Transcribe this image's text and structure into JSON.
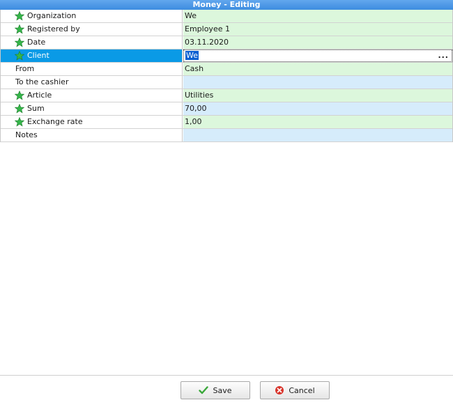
{
  "window": {
    "title": "Money - Editing"
  },
  "fields": [
    {
      "label": "Organization",
      "value": "We",
      "required": true,
      "tone": "green"
    },
    {
      "label": "Registered by",
      "value": "Employee 1",
      "required": true,
      "tone": "green"
    },
    {
      "label": "Date",
      "value": "03.11.2020",
      "required": true,
      "tone": "green"
    },
    {
      "label": "Client",
      "value": "We",
      "required": true,
      "tone": "white",
      "selected": true
    },
    {
      "label": "From",
      "value": "Cash",
      "required": false,
      "tone": "green"
    },
    {
      "label": "To the cashier",
      "value": "",
      "required": false,
      "tone": "blue"
    },
    {
      "label": "Article",
      "value": "Utilities",
      "required": true,
      "tone": "green"
    },
    {
      "label": "Sum",
      "value": "70,00",
      "required": true,
      "tone": "blue"
    },
    {
      "label": "Exchange rate",
      "value": "1,00",
      "required": true,
      "tone": "green"
    },
    {
      "label": "Notes",
      "value": "",
      "required": false,
      "tone": "blue"
    }
  ],
  "client_picker": {
    "ellipsis": "..."
  },
  "buttons": {
    "save": "Save",
    "cancel": "Cancel"
  },
  "colors": {
    "title_bar": "#3d8ce0",
    "selected_label": "#0a9ae6",
    "value_green": "#dcf7dc",
    "value_blue": "#d6ecfb",
    "star": "#35b54a"
  },
  "icons": {
    "required": "star-icon",
    "save": "checkmark-icon",
    "cancel": "cancel-icon"
  }
}
